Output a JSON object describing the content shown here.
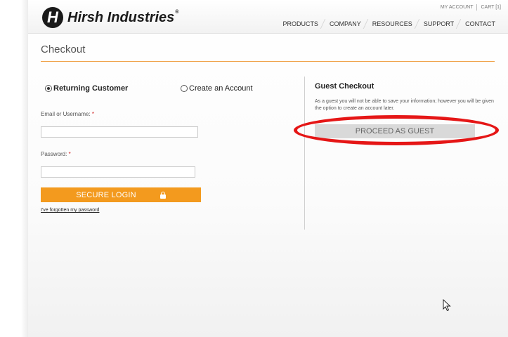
{
  "brand": {
    "name": "Hirsh Industries",
    "mark": "H",
    "reg": "®"
  },
  "util_nav": {
    "my_account": "MY ACCOUNT",
    "cart": "CART [1]"
  },
  "main_nav": [
    "PRODUCTS",
    "COMPANY",
    "RESOURCES",
    "SUPPORT",
    "CONTACT"
  ],
  "page_title": "Checkout",
  "login": {
    "returning_label": "Returning Customer",
    "returning_selected": true,
    "create_label": "Create an Account",
    "email_label": "Email or Username:",
    "email_value": "",
    "password_label": "Password:",
    "password_value": "",
    "required_mark": "*",
    "secure_login_label": "SECURE LOGIN",
    "forgot_label": "I've forgotten my password"
  },
  "guest": {
    "title": "Guest Checkout",
    "text": "As a guest you will not be able to save your information; however you will be given the option to create an account later.",
    "proceed_label": "PROCEED AS GUEST"
  },
  "icons": {
    "lock": "lock-icon",
    "cursor": "mouse-pointer-icon"
  },
  "colors": {
    "accent": "#f39a1e",
    "annotation": "#e51616",
    "guest_button": "#d9d9d9"
  }
}
